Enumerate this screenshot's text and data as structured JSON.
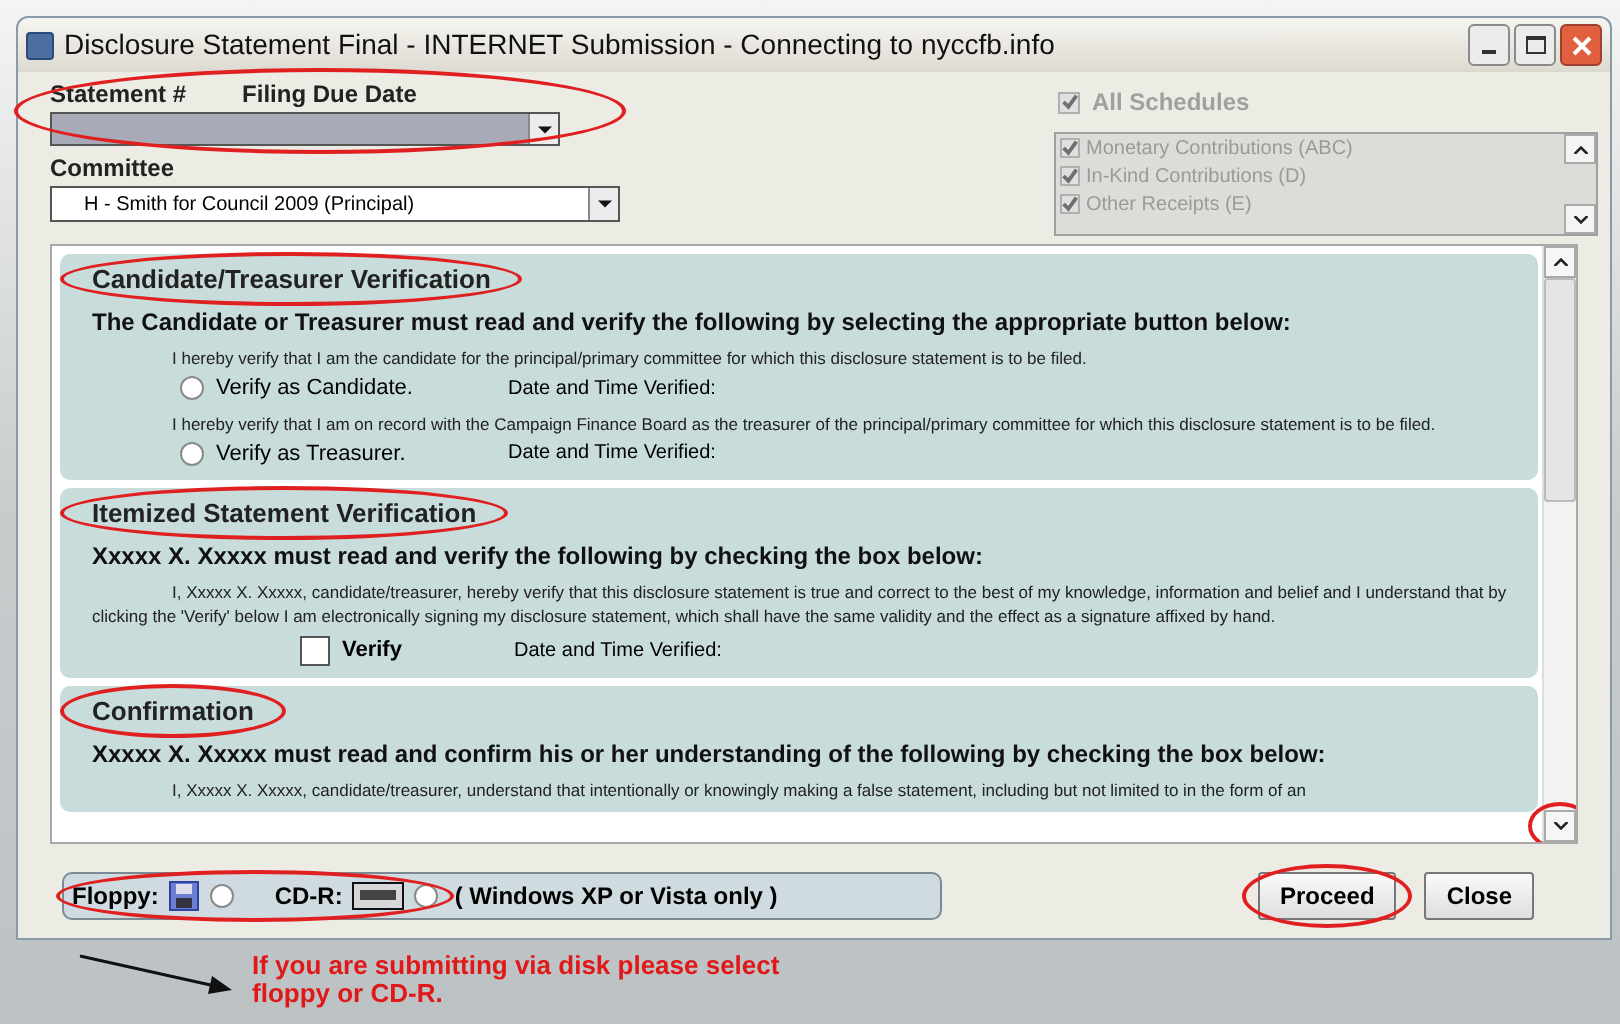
{
  "window": {
    "title": "Disclosure Statement  Final - INTERNET Submission - Connecting to nyccfb.info"
  },
  "statement": {
    "labels": [
      "Statement #",
      "Filing Due Date"
    ],
    "circled": true
  },
  "committee": {
    "label": "Committee",
    "value": "H - Smith for Council 2009 (Principal)"
  },
  "schedules": {
    "label": "All Schedules",
    "checked": true,
    "items": [
      {
        "label": "Monetary Contributions (ABC)",
        "checked": true
      },
      {
        "label": "In-Kind Contributions (D)",
        "checked": true
      },
      {
        "label": "Other Receipts (E)",
        "checked": true
      }
    ]
  },
  "sections": [
    {
      "title": "Candidate/Treasurer Verification",
      "circled": true,
      "instruction": "The Candidate or Treasurer must read and verify the following by selecting the appropriate button below:",
      "rows": [
        {
          "kind": "note",
          "text": "I hereby verify that I am the candidate for the principal/primary committee for which this disclosure statement is to be filed."
        },
        {
          "kind": "radio",
          "label": "Verify as Candidate.",
          "selected": false,
          "verified_label": "Date and Time Verified:"
        },
        {
          "kind": "note",
          "text": "I hereby verify that I am on record with the Campaign Finance Board as the treasurer of the principal/primary committee for which this disclosure statement is to be filed."
        },
        {
          "kind": "radio",
          "label": "Verify as Treasurer.",
          "selected": false,
          "verified_label": "Date and Time Verified:"
        }
      ]
    },
    {
      "title": "Itemized Statement Verification",
      "circled": true,
      "instruction": "Xxxxx X. Xxxxx must read and verify the following by checking the box below:",
      "rows": [
        {
          "kind": "note",
          "text": "I, Xxxxx X. Xxxxx, candidate/treasurer, hereby verify that this disclosure statement is true and correct to the best of my knowledge, information and belief and I understand that by clicking the 'Verify' below I am electronically signing my disclosure statement, which shall have the same validity and the effect as a signature affixed by hand."
        },
        {
          "kind": "checkbox",
          "label": "Verify",
          "checked": false,
          "verified_label": "Date and Time Verified:"
        }
      ]
    },
    {
      "title": "Confirmation",
      "circled": true,
      "instruction": "Xxxxx X. Xxxxx must read and confirm his or her understanding of the following by checking the box below:",
      "rows": [
        {
          "kind": "note",
          "text": "I, Xxxxx X. Xxxxx, candidate/treasurer, understand that intentionally or knowingly making a false statement, including but not limited to in the form of an"
        }
      ]
    }
  ],
  "scrollbar": {
    "down_circled": true
  },
  "media": {
    "circled": true,
    "options": [
      {
        "kind": "floppy",
        "label": "Floppy:",
        "selected": false
      },
      {
        "kind": "cd",
        "label": "CD-R:",
        "selected": false
      }
    ],
    "note": "( Windows XP or Vista only )"
  },
  "buttons": [
    {
      "label": "Proceed",
      "circled": true
    },
    {
      "label": "Close",
      "circled": false
    }
  ],
  "annotation": {
    "text": "If you are submitting via disk please select floppy or CD-R."
  }
}
